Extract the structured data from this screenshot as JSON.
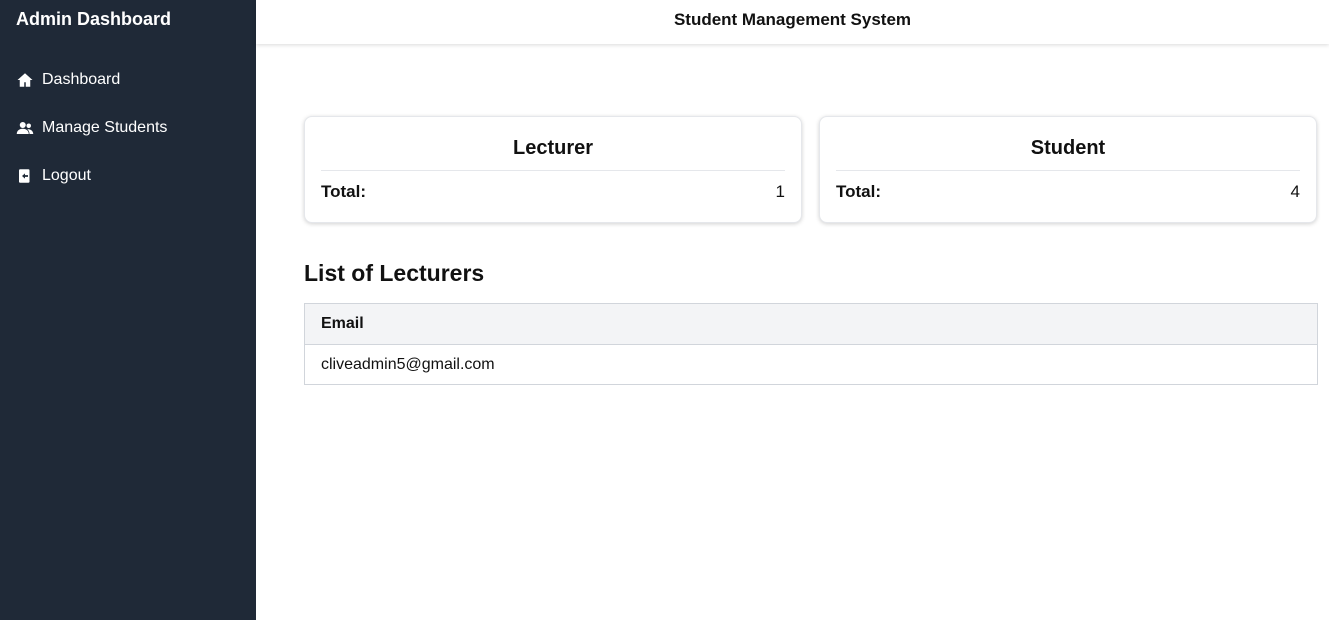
{
  "sidebar": {
    "title": "Admin Dashboard",
    "items": [
      {
        "label": "Dashboard",
        "icon": "home-icon"
      },
      {
        "label": "Manage Students",
        "icon": "users-icon"
      },
      {
        "label": "Logout",
        "icon": "logout-icon"
      }
    ]
  },
  "header": {
    "title": "Student Management System"
  },
  "cards": {
    "lecturer": {
      "title": "Lecturer",
      "label": "Total:",
      "value": "1"
    },
    "student": {
      "title": "Student",
      "label": "Total:",
      "value": "4"
    }
  },
  "lecturers": {
    "title": "List of Lecturers",
    "columns": [
      "Email"
    ],
    "rows": [
      [
        "cliveadmin5@gmail.com"
      ]
    ]
  },
  "colors": {
    "sidebar_bg": "#1f2937",
    "table_header_bg": "#f3f4f6"
  }
}
